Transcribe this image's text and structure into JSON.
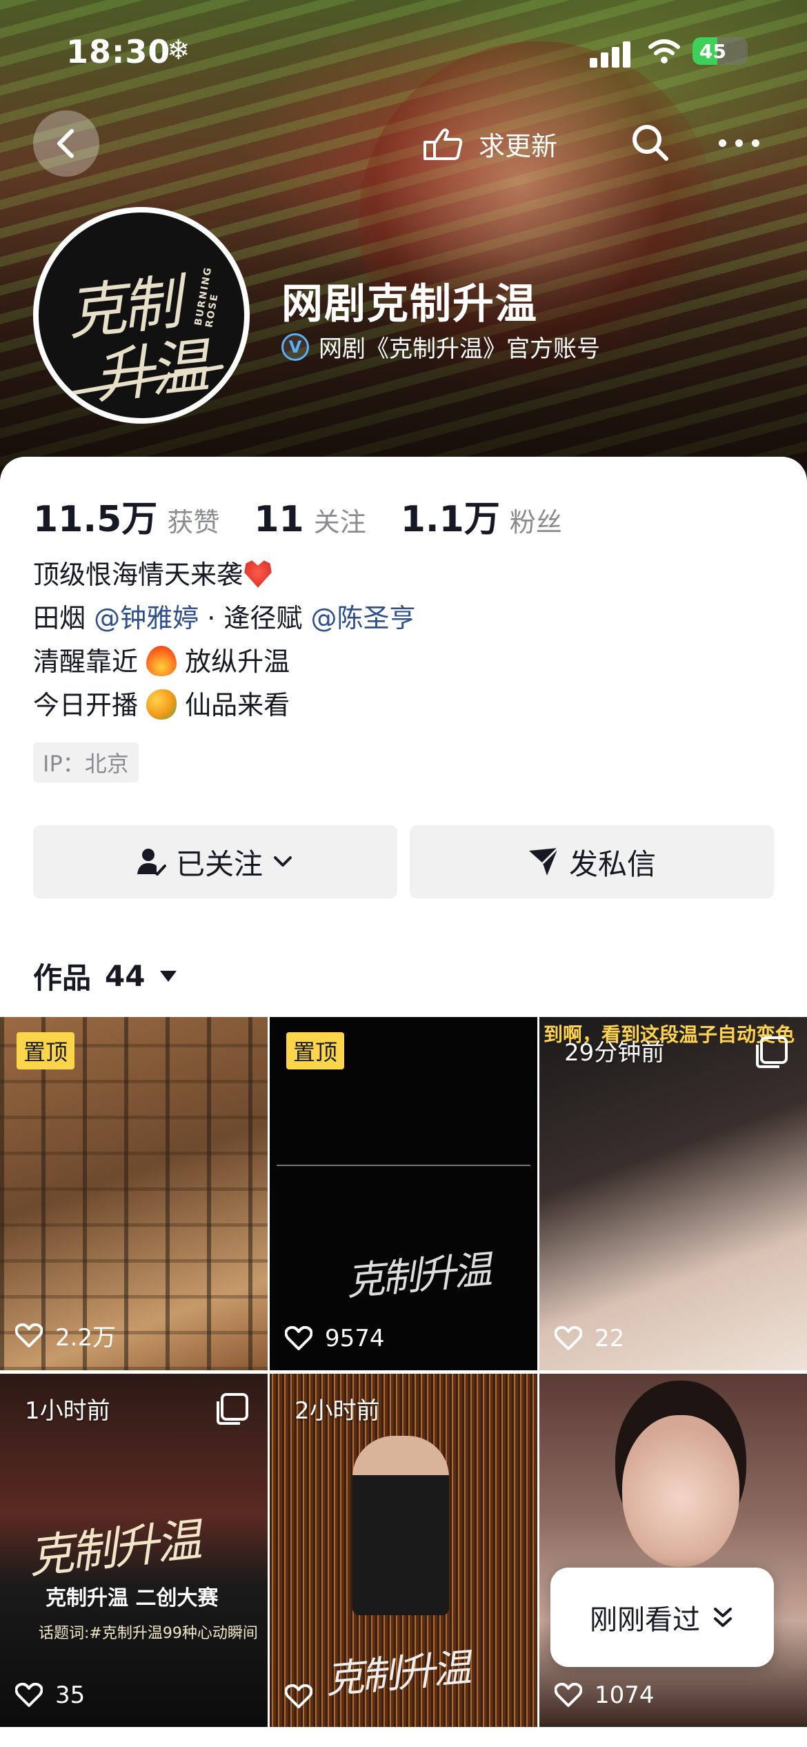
{
  "status_bar": {
    "time": "18:30",
    "weather_icon": "snowflake-icon",
    "battery": "45",
    "battery_level": 0.45
  },
  "nav": {
    "update_label": "求更新"
  },
  "profile": {
    "name": "网剧克制升温",
    "verified_text": "网剧《克制升温》官方账号",
    "avatar_logo_line1": "克制",
    "avatar_logo_line2": "升温",
    "avatar_logo_en": "BURNING ROSE"
  },
  "stats": [
    {
      "value": "11.5万",
      "label": "获赞"
    },
    {
      "value": "11",
      "label": "关注"
    },
    {
      "value": "1.1万",
      "label": "粉丝"
    }
  ],
  "bio": {
    "line1": "顶级恨海情天来袭",
    "line2_a": "田烟 ",
    "line2_mention1": "@钟雅婷",
    "line2_b": " · 逄径赋 ",
    "line2_mention2": "@陈圣亨",
    "line3_a": "清醒靠近 ",
    "line3_b": " 放纵升温",
    "line4_a": "今日开播 ",
    "line4_b": " 仙品来看"
  },
  "ip": "IP：北京",
  "actions": {
    "follow": "已关注",
    "message": "发私信"
  },
  "works": {
    "title": "作品",
    "count": "44"
  },
  "grid": [
    {
      "pin": "置顶",
      "likes": "2.2万"
    },
    {
      "pin": "置顶",
      "likes": "9574",
      "logo": "克制升温"
    },
    {
      "time": "29分钟前",
      "likes": "22",
      "caption": "到啊，看到这段温子自动变色"
    },
    {
      "time": "1小时前",
      "likes": "35",
      "logo": "克制升温",
      "subtitle": "克制升温 二创大赛",
      "topic": "话题词:#克制升温99种心动瞬间"
    },
    {
      "time": "2小时前",
      "likes": "",
      "logo": "克制升温"
    },
    {
      "likes": "1074"
    }
  ],
  "recently_viewed": "刚刚看过"
}
